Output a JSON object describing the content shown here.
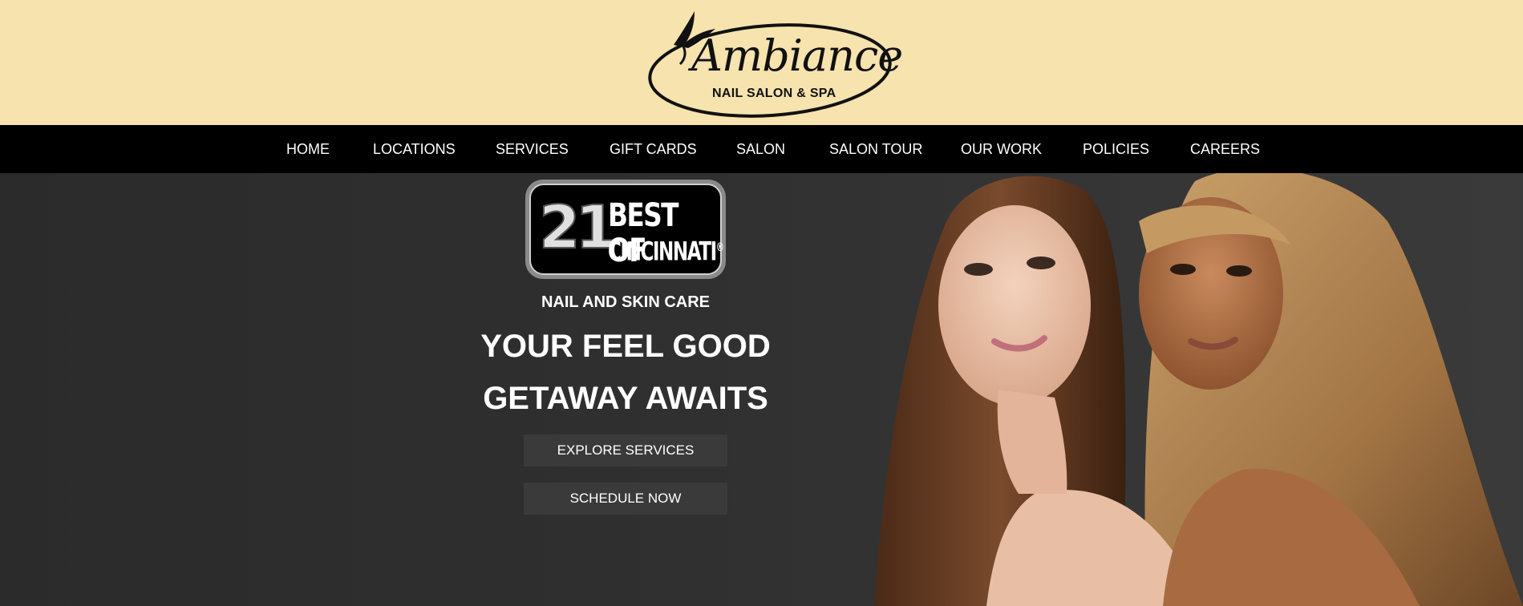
{
  "brand": {
    "name": "Ambiance",
    "tagline": "NAIL SALON & SPA"
  },
  "nav": {
    "items": [
      {
        "label": "HOME"
      },
      {
        "label": "LOCATIONS"
      },
      {
        "label": "SERVICES"
      },
      {
        "label": "GIFT CARDS"
      },
      {
        "label": "SALON"
      },
      {
        "label": "SALON TOUR"
      },
      {
        "label": "OUR WORK"
      },
      {
        "label": "POLICIES"
      },
      {
        "label": "CAREERS"
      }
    ]
  },
  "hero": {
    "badge": {
      "number": "21",
      "line1": "BEST OF",
      "line2": "CINCINNATI",
      "mark": "®"
    },
    "kicker": "NAIL AND SKIN CARE",
    "headline_line1": "YOUR FEEL GOOD",
    "headline_line2": "GETAWAY AWAITS",
    "buttons": {
      "explore": "EXPLORE SERVICES",
      "schedule": "SCHEDULE NOW"
    }
  },
  "colors": {
    "header_bg": "#f6e3ae",
    "nav_bg": "#000000",
    "hero_bg": "#2f2f2f",
    "button_bg": "#3a3a3a"
  },
  "icons": [
    "swallow-logo-icon"
  ]
}
